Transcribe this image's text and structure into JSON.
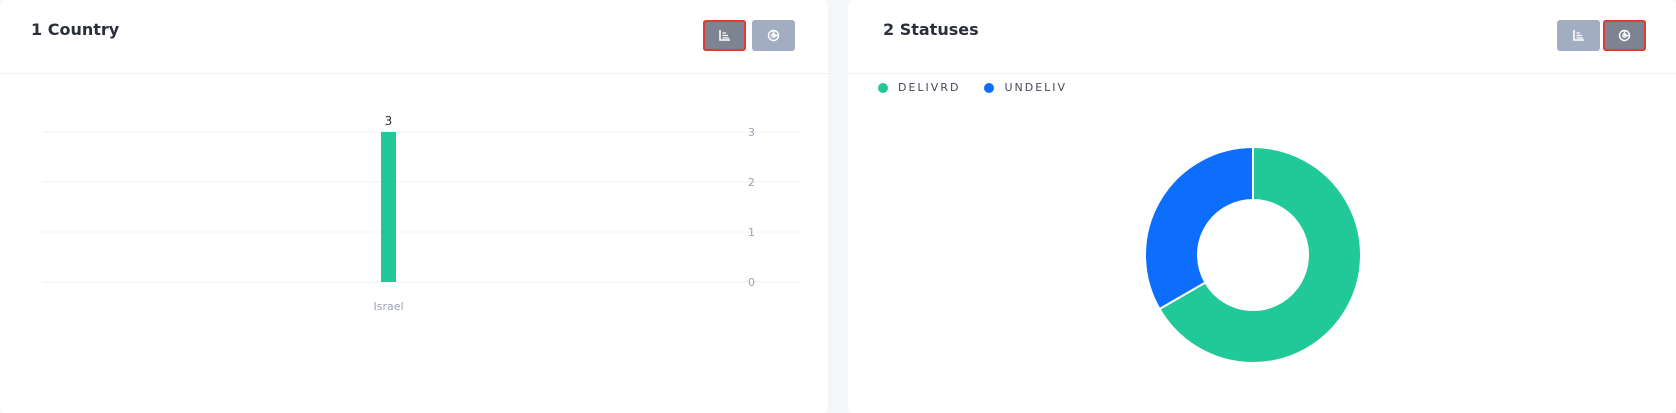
{
  "left_card": {
    "title": "1 Country",
    "buttons": [
      {
        "icon": "bar-chart-icon",
        "selected": true
      },
      {
        "icon": "pie-chart-icon",
        "selected": false
      }
    ]
  },
  "right_card": {
    "title": "2 Statuses",
    "buttons": [
      {
        "icon": "bar-chart-icon",
        "selected": false
      },
      {
        "icon": "pie-chart-icon",
        "selected": true
      }
    ]
  },
  "colors": {
    "green": "#20c997",
    "blue": "#0d6efd",
    "selected_outline": "#e53935"
  },
  "chart_data": [
    {
      "type": "bar",
      "categories": [
        "Israel"
      ],
      "values": [
        3
      ],
      "data_labels": [
        "3"
      ],
      "ylim": [
        0,
        3
      ],
      "yticks": [
        "0",
        "1",
        "2",
        "3"
      ],
      "grid": true,
      "y_axis_side": "right",
      "color": "#20c997"
    },
    {
      "type": "pie",
      "donut": true,
      "legend_position": "top-left",
      "labels": [
        "DELIVRD",
        "UNDELIV"
      ],
      "values": [
        2,
        1
      ],
      "colors": [
        "#20c997",
        "#0d6efd"
      ]
    }
  ]
}
